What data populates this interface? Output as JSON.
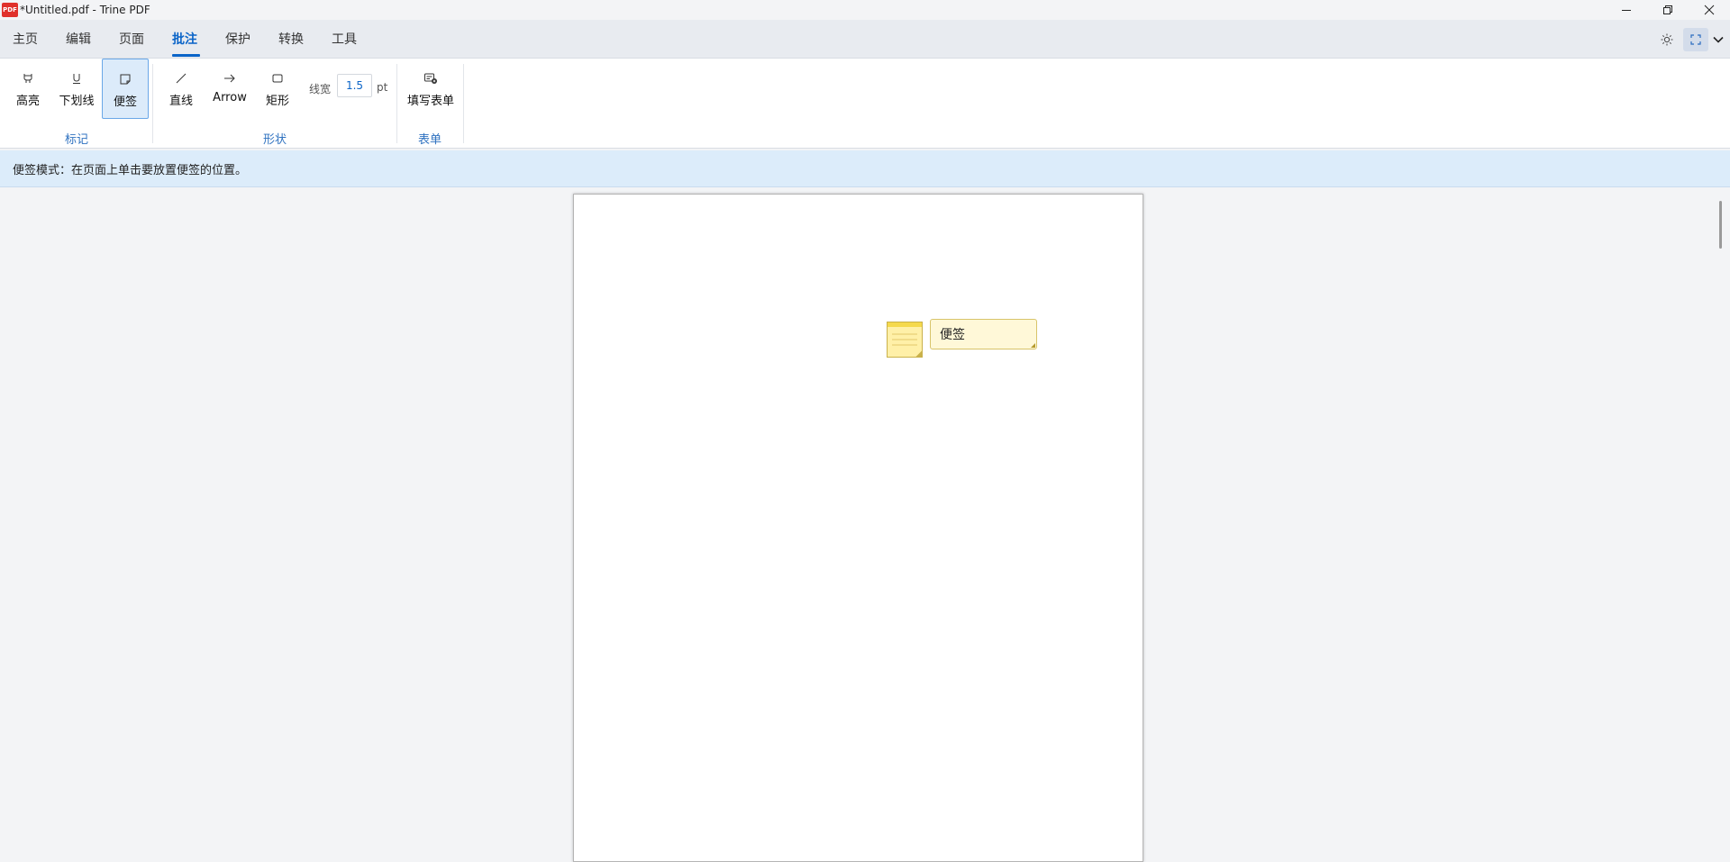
{
  "window": {
    "app_icon_text": "PDF",
    "title": "*Untitled.pdf - Trine PDF"
  },
  "tabs": [
    {
      "label": "主页"
    },
    {
      "label": "编辑"
    },
    {
      "label": "页面"
    },
    {
      "label": "批注",
      "active": true
    },
    {
      "label": "保护"
    },
    {
      "label": "转换"
    },
    {
      "label": "工具"
    }
  ],
  "ribbon": {
    "markup": {
      "group_label": "标记",
      "highlight": "高亮",
      "underline": "下划线",
      "sticky_note": "便签"
    },
    "shapes": {
      "group_label": "形状",
      "line": "直线",
      "arrow": "Arrow",
      "rectangle": "矩形",
      "line_width_label": "线宽",
      "line_width_value": "1.5",
      "line_width_unit": "pt"
    },
    "form": {
      "group_label": "表单",
      "fill_form": "填写表单"
    }
  },
  "infobar": {
    "message": "便签模式：在页面上单击要放置便签的位置。"
  },
  "document": {
    "note_text": "便签"
  },
  "colors": {
    "accent": "#0a64c8",
    "infobar_bg": "#dcecfa",
    "note_bg": "#fff8d8"
  }
}
